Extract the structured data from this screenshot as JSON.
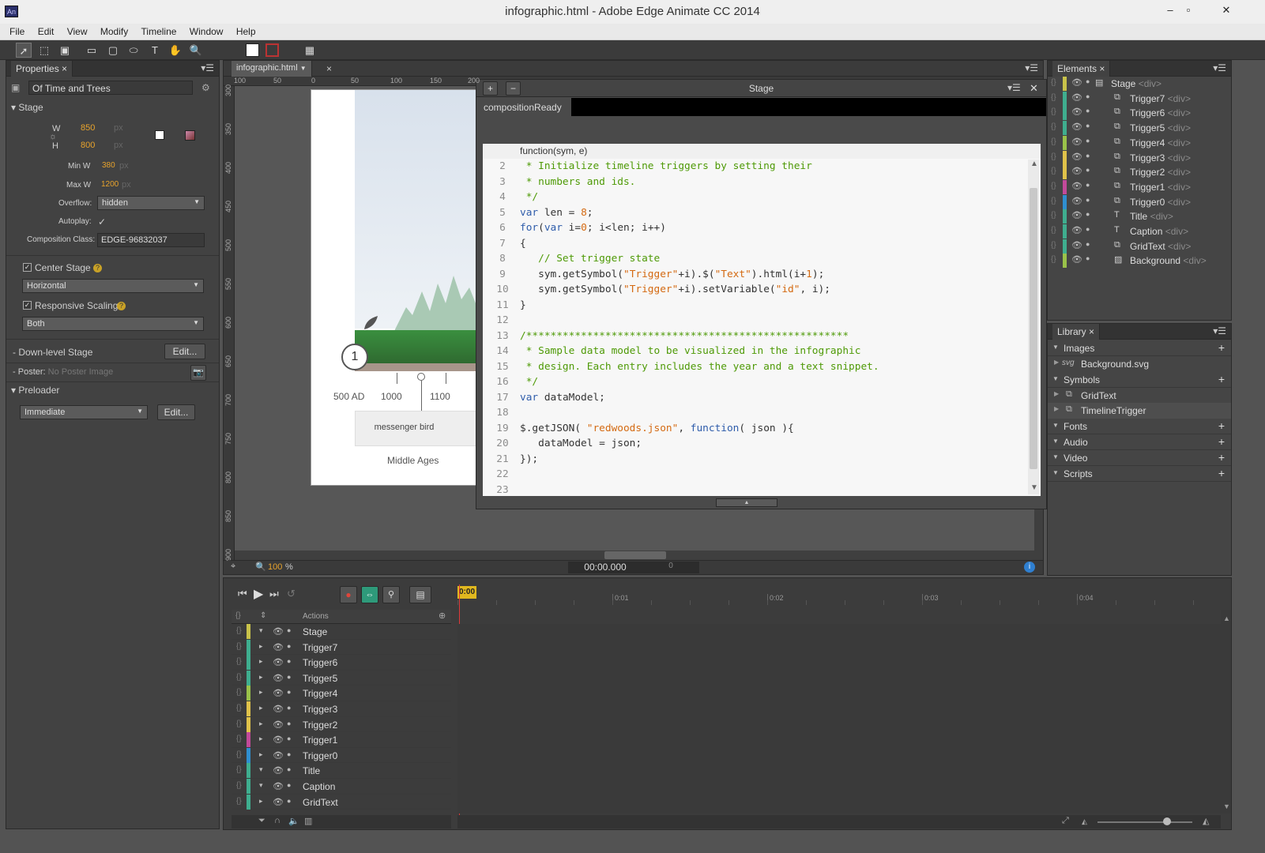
{
  "window": {
    "title": "infographic.html - Adobe Edge Animate CC 2014",
    "app_icon": "An",
    "minimize": "–",
    "maximize": "▫",
    "close": "✕"
  },
  "menu": [
    "File",
    "Edit",
    "View",
    "Modify",
    "Timeline",
    "Window",
    "Help"
  ],
  "properties": {
    "tab": "Properties",
    "close": "×",
    "composition_name": "Of Time and Trees",
    "stage_section": "Stage",
    "w_label": "W",
    "w_value": "850",
    "w_unit": "px",
    "h_label": "H",
    "h_value": "800",
    "h_unit": "px",
    "min_w_label": "Min W",
    "min_w_value": "380",
    "min_w_unit": "px",
    "max_w_label": "Max W",
    "max_w_value": "1200",
    "max_w_unit": "px",
    "overflow_label": "Overflow:",
    "overflow_value": "hidden",
    "autoplay_label": "Autoplay:",
    "autoplay_check": "✓",
    "comp_class_label": "Composition Class:",
    "comp_class_value": "EDGE-96832037",
    "center_stage_label": "Center Stage",
    "center_stage_value": "Horizontal",
    "responsive_label": "Responsive Scaling",
    "responsive_value": "Both",
    "downlevel_label": "Down-level Stage",
    "downlevel_button": "Edit...",
    "poster_label": "Poster:",
    "poster_value": "No Poster Image",
    "preloader_section": "Preloader",
    "preloader_value": "Immediate",
    "preloader_button": "Edit...",
    "help_glyph": "?"
  },
  "document": {
    "tab": "infographic.html",
    "tab_close": "×",
    "ruler_top": [
      "100",
      "50",
      "0",
      "50",
      "100",
      "150",
      "200"
    ],
    "ruler_left": [
      "300",
      "350",
      "400",
      "450",
      "500",
      "550",
      "600",
      "650",
      "700",
      "750",
      "800",
      "850",
      "900"
    ],
    "zoom_value": "100",
    "zoom_unit": "%",
    "time": "00:00.000",
    "frame": "0",
    "stage_art": {
      "marker_number": "1",
      "years": [
        "500 AD",
        "1000",
        "1100"
      ],
      "card_text": "messenger bird",
      "era": "Middle Ages"
    }
  },
  "code_panel": {
    "title": "Stage",
    "close": "✕",
    "plus": "+",
    "minus": "−",
    "event_tab": "compositionReady",
    "function_header": "function(sym, e)"
  },
  "code_lines": [
    {
      "n": "2",
      "text": " * Initialize timeline triggers by setting their"
    },
    {
      "n": "3",
      "text": " * numbers and ids."
    },
    {
      "n": "4",
      "text": " */"
    },
    {
      "n": "5",
      "text": "var len = 8;"
    },
    {
      "n": "6",
      "text": "for(var i=0; i<len; i++)"
    },
    {
      "n": "7",
      "text": "{"
    },
    {
      "n": "8",
      "text": "   // Set trigger state"
    },
    {
      "n": "9",
      "text": "   sym.getSymbol(\"Trigger\"+i).$(\"Text\").html(i+1);"
    },
    {
      "n": "10",
      "text": "   sym.getSymbol(\"Trigger\"+i).setVariable(\"id\", i);"
    },
    {
      "n": "11",
      "text": "}"
    },
    {
      "n": "12",
      "text": ""
    },
    {
      "n": "13",
      "text": "/*****************************************************"
    },
    {
      "n": "14",
      "text": " * Sample data model to be visualized in the infographic"
    },
    {
      "n": "15",
      "text": " * design. Each entry includes the year and a text snippet."
    },
    {
      "n": "16",
      "text": " */"
    },
    {
      "n": "17",
      "text": "var dataModel;"
    },
    {
      "n": "18",
      "text": ""
    },
    {
      "n": "19",
      "text": "$.getJSON( \"redwoods.json\", function( json ){"
    },
    {
      "n": "20",
      "text": "   dataModel = json;"
    },
    {
      "n": "21",
      "text": "});"
    },
    {
      "n": "22",
      "text": ""
    },
    {
      "n": "23",
      "text": ""
    }
  ],
  "elements": {
    "tab": "Elements",
    "close": "×",
    "items": [
      {
        "name": "Stage",
        "tag": "<div>",
        "color": "#c8c24a",
        "icon": "stage-icon"
      },
      {
        "name": "Trigger7",
        "tag": "<div>",
        "color": "#3fae8f",
        "icon": "symbol-icon"
      },
      {
        "name": "Trigger6",
        "tag": "<div>",
        "color": "#3fae8f",
        "icon": "symbol-icon"
      },
      {
        "name": "Trigger5",
        "tag": "<div>",
        "color": "#3fae8f",
        "icon": "symbol-icon"
      },
      {
        "name": "Trigger4",
        "tag": "<div>",
        "color": "#9ac24a",
        "icon": "symbol-icon"
      },
      {
        "name": "Trigger3",
        "tag": "<div>",
        "color": "#e0c24a",
        "icon": "symbol-icon"
      },
      {
        "name": "Trigger2",
        "tag": "<div>",
        "color": "#e0c24a",
        "icon": "symbol-icon"
      },
      {
        "name": "Trigger1",
        "tag": "<div>",
        "color": "#c24a9a",
        "icon": "symbol-icon"
      },
      {
        "name": "Trigger0",
        "tag": "<div>",
        "color": "#2f8fd0",
        "icon": "symbol-icon"
      },
      {
        "name": "Title",
        "tag": "<div>",
        "color": "#3fae8f",
        "icon": "text-icon"
      },
      {
        "name": "Caption",
        "tag": "<div>",
        "color": "#3fae8f",
        "icon": "text-icon"
      },
      {
        "name": "GridText",
        "tag": "<div>",
        "color": "#3fae8f",
        "icon": "symbol-icon"
      },
      {
        "name": "Background",
        "tag": "<div>",
        "color": "#9ac24a",
        "icon": "image-icon"
      }
    ]
  },
  "library": {
    "tab": "Library",
    "close": "×",
    "images_label": "Images",
    "image_item": "Background.svg",
    "image_item_type": "svg",
    "symbols_label": "Symbols",
    "symbol_items": [
      "GridText",
      "TimelineTrigger"
    ],
    "fonts_label": "Fonts",
    "audio_label": "Audio",
    "video_label": "Video",
    "scripts_label": "Scripts"
  },
  "timeline": {
    "actions_label": "Actions",
    "ticks": [
      "0:00",
      "0:01",
      "0:02",
      "0:03",
      "0:04"
    ],
    "rows": [
      {
        "name": "Stage",
        "color": "#c8c24a",
        "twisty": "▾"
      },
      {
        "name": "Trigger7",
        "color": "#3fae8f",
        "twisty": "▸"
      },
      {
        "name": "Trigger6",
        "color": "#3fae8f",
        "twisty": "▸"
      },
      {
        "name": "Trigger5",
        "color": "#3fae8f",
        "twisty": "▸"
      },
      {
        "name": "Trigger4",
        "color": "#9ac24a",
        "twisty": "▸"
      },
      {
        "name": "Trigger3",
        "color": "#e0c24a",
        "twisty": "▸"
      },
      {
        "name": "Trigger2",
        "color": "#e0c24a",
        "twisty": "▸"
      },
      {
        "name": "Trigger1",
        "color": "#c24a9a",
        "twisty": "▸"
      },
      {
        "name": "Trigger0",
        "color": "#2f8fd0",
        "twisty": "▸"
      },
      {
        "name": "Title",
        "color": "#3fae8f",
        "twisty": "▾"
      },
      {
        "name": "Caption",
        "color": "#3fae8f",
        "twisty": "▾"
      },
      {
        "name": "GridText",
        "color": "#3fae8f",
        "twisty": "▸"
      }
    ]
  }
}
